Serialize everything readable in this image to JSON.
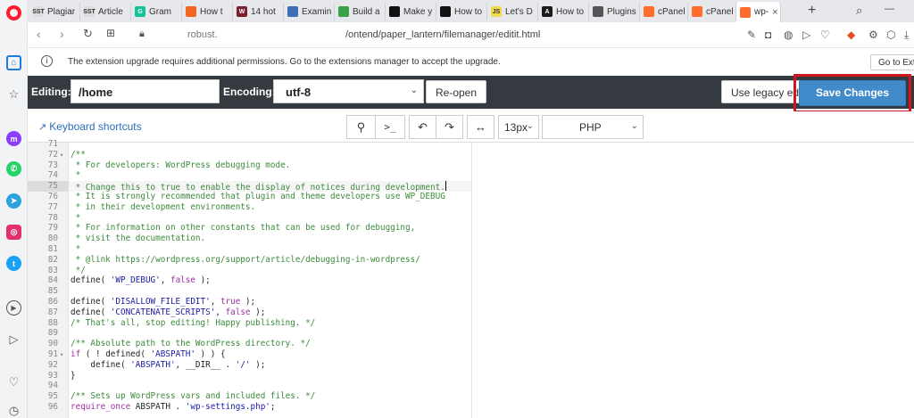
{
  "sidebar": {
    "items": [
      {
        "name": "home",
        "icon": "home-icon"
      },
      {
        "name": "speed-dial",
        "icon": "star-icon"
      },
      {
        "name": "messenger",
        "icon": "messenger-icon",
        "color": "#8a3ffc"
      },
      {
        "name": "whatsapp",
        "icon": "whatsapp-icon",
        "color": "#25d366"
      },
      {
        "name": "telegram",
        "icon": "telegram-icon",
        "color": "#2aa3de"
      },
      {
        "name": "instagram",
        "icon": "instagram-icon",
        "color": "#e1306c"
      },
      {
        "name": "twitter",
        "icon": "twitter-icon",
        "color": "#1da1f2"
      },
      {
        "name": "player",
        "icon": "play-icon"
      },
      {
        "name": "send",
        "icon": "send-icon"
      },
      {
        "name": "favorites",
        "icon": "heart-icon"
      },
      {
        "name": "history",
        "icon": "clock-icon"
      }
    ]
  },
  "tabs": [
    {
      "title": "Plagiar",
      "favicon_text": "SST",
      "favicon_color": "#dddddd"
    },
    {
      "title": "Article",
      "favicon_text": "SST",
      "favicon_color": "#dddddd"
    },
    {
      "title": "Gram",
      "favicon_text": "G",
      "favicon_color": "#15c39a"
    },
    {
      "title": "How t",
      "favicon_text": "",
      "favicon_color": "#f26522"
    },
    {
      "title": "14 hot",
      "favicon_text": "W",
      "favicon_color": "#7b1f2f"
    },
    {
      "title": "Examin",
      "favicon_text": "",
      "favicon_color": "#3d6fb6"
    },
    {
      "title": "Build a",
      "favicon_text": "",
      "favicon_color": "#3aa34a"
    },
    {
      "title": "Make y",
      "favicon_text": "",
      "favicon_color": "#111111"
    },
    {
      "title": "How to",
      "favicon_text": "",
      "favicon_color": "#111111"
    },
    {
      "title": "Let's D",
      "favicon_text": "JS",
      "favicon_color": "#f0db4f"
    },
    {
      "title": "How to",
      "favicon_text": "A",
      "favicon_color": "#1b1b1b"
    },
    {
      "title": "Plugins",
      "favicon_text": "",
      "favicon_color": "#555555"
    },
    {
      "title": "cPanel",
      "favicon_text": "",
      "favicon_color": "#ff6c2c"
    },
    {
      "title": "cPanel",
      "favicon_text": "",
      "favicon_color": "#ff6c2c"
    },
    {
      "title": "wp-",
      "favicon_text": "",
      "favicon_color": "#ff6c2c",
      "active": true,
      "close": "×"
    }
  ],
  "tabstrip": {
    "new_tab": "+"
  },
  "address": {
    "host": "robust.",
    "path": "/ontend/paper_lantern/filemanager/editit.html"
  },
  "notice": {
    "info_glyph": "i",
    "text": "The extension upgrade requires additional permissions. Go to the extensions manager to accept the upgrade.",
    "button": "Go to Exte"
  },
  "toolbar": {
    "editing_label": "Editing:",
    "editing_value": "/home",
    "encoding_label": "Encoding:",
    "encoding_value": "utf-8",
    "reopen": "Re-open",
    "legacy": "Use legacy editor",
    "save": "Save Changes"
  },
  "subbar": {
    "keyboard_shortcuts": "Keyboard shortcuts",
    "font_size": "13px",
    "mode": "PHP"
  },
  "code_lines": [
    {
      "n": "71",
      "text": "",
      "type": "plain"
    },
    {
      "n": "72",
      "text": "/**",
      "type": "comment",
      "fold": true
    },
    {
      "n": "73",
      "text": " * For developers: WordPress debugging mode.",
      "type": "comment"
    },
    {
      "n": "74",
      "text": " *",
      "type": "comment"
    },
    {
      "n": "75",
      "text": " * Change this to true to enable the display of notices during development.",
      "type": "comment",
      "active": true
    },
    {
      "n": "76",
      "text": " * It is strongly recommended that plugin and theme developers use WP_DEBUG",
      "type": "comment"
    },
    {
      "n": "77",
      "text": " * in their development environments.",
      "type": "comment"
    },
    {
      "n": "78",
      "text": " *",
      "type": "comment"
    },
    {
      "n": "79",
      "text": " * For information on other constants that can be used for debugging,",
      "type": "comment"
    },
    {
      "n": "80",
      "text": " * visit the documentation.",
      "type": "comment"
    },
    {
      "n": "81",
      "text": " *",
      "type": "comment"
    },
    {
      "n": "82",
      "text": " * @link https://wordpress.org/support/article/debugging-in-wordpress/",
      "type": "comment"
    },
    {
      "n": "83",
      "text": " */",
      "type": "comment"
    },
    {
      "n": "84",
      "text": "define( 'WP_DEBUG', false );",
      "type": "code"
    },
    {
      "n": "85",
      "text": "",
      "type": "plain"
    },
    {
      "n": "86",
      "text": "define( 'DISALLOW_FILE_EDIT', true );",
      "type": "code"
    },
    {
      "n": "87",
      "text": "define( 'CONCATENATE_SCRIPTS', false );",
      "type": "code"
    },
    {
      "n": "88",
      "text": "/* That's all, stop editing! Happy publishing. */",
      "type": "comment"
    },
    {
      "n": "89",
      "text": "",
      "type": "plain"
    },
    {
      "n": "90",
      "text": "/** Absolute path to the WordPress directory. */",
      "type": "comment"
    },
    {
      "n": "91",
      "text": "if ( ! defined( 'ABSPATH' ) ) {",
      "type": "code",
      "fold": true
    },
    {
      "n": "92",
      "text": "    define( 'ABSPATH', __DIR__ . '/' );",
      "type": "code"
    },
    {
      "n": "93",
      "text": "}",
      "type": "code"
    },
    {
      "n": "94",
      "text": "",
      "type": "plain"
    },
    {
      "n": "95",
      "text": "/** Sets up WordPress vars and included files. */",
      "type": "comment"
    },
    {
      "n": "96",
      "text": "require_once ABSPATH . 'wp-settings.php';",
      "type": "code"
    }
  ]
}
